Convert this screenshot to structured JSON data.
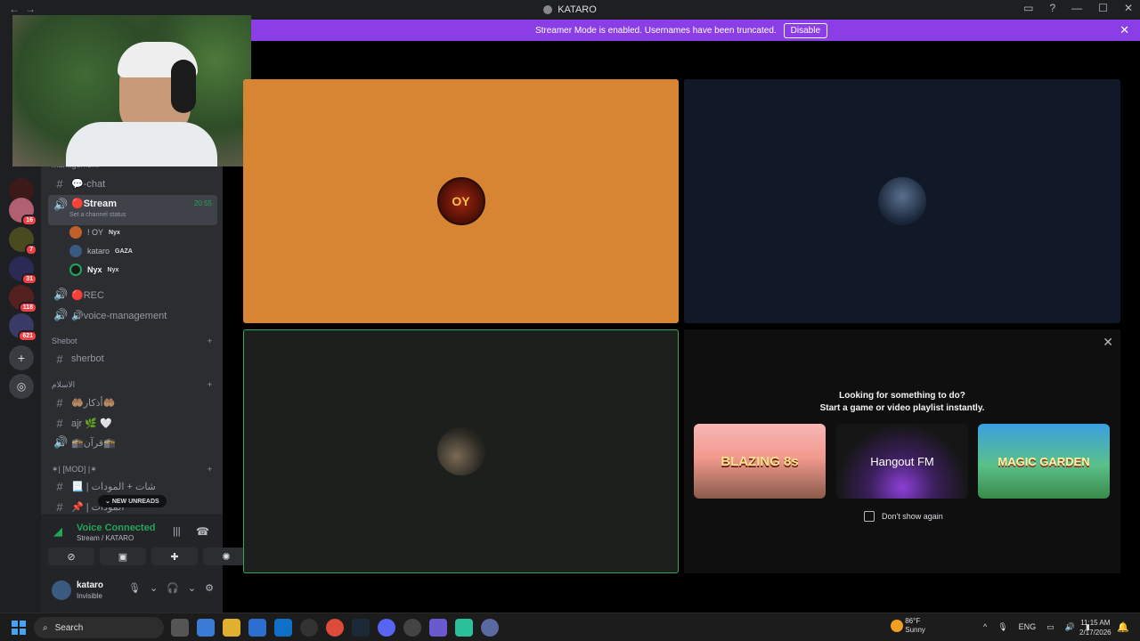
{
  "window": {
    "title": "KATARO",
    "back": "←",
    "forward": "→"
  },
  "banner": {
    "text": "Streamer Mode is enabled. Usernames have been truncated.",
    "button": "Disable"
  },
  "servers": [
    {
      "badge": "16"
    },
    {
      "badge": "7"
    },
    {
      "badge": "31"
    },
    {
      "badge": "118"
    },
    {
      "badge": "621"
    }
  ],
  "channels": {
    "partial_category": "Management",
    "items": [
      {
        "icon": "#",
        "name": "💬-chat"
      },
      {
        "icon": "🔊",
        "name": "🔴Stream",
        "status": "Set a channel status",
        "time": "20:55"
      },
      {
        "icon": "🔊",
        "name": "🔴REC"
      },
      {
        "icon": "🔊",
        "name": "🔊voice-management"
      }
    ],
    "voice_users": [
      {
        "name": "! OY",
        "tag": "Nyx"
      },
      {
        "name": "kataro",
        "tag": "GAZA"
      },
      {
        "name": "Nyx",
        "tag": "Nyx"
      }
    ],
    "cat_shebot": "Shebot",
    "sherbot": "sherbot",
    "cat_islam": "الاسلام",
    "islam": [
      {
        "icon": "#",
        "name": "🤲🏽أذكار🤲🏽"
      },
      {
        "icon": "#",
        "name": "ajr 🌿 🤍"
      },
      {
        "icon": "🔊",
        "name": "🕋قرآن🕋"
      }
    ],
    "cat_mod": "✶| [MOD] |✶",
    "mod": [
      {
        "icon": "#",
        "name": "📃 | شات + المودات"
      },
      {
        "icon": "#",
        "name": "📌 | المودات"
      }
    ],
    "new_unreads": "NEW UNREADS"
  },
  "voice": {
    "title": "Voice Connected",
    "sub": "Stream / KATARO"
  },
  "user": {
    "name": "kataro",
    "status": "Invisible"
  },
  "tiles": [
    {
      "label": "OY",
      "bg": "#d88533"
    },
    {
      "label": "",
      "bg": "#111827"
    },
    {
      "label": "",
      "bg": "#1d1f1c"
    }
  ],
  "activity": {
    "line1": "Looking for something to do?",
    "line2": "Start a game or video playlist instantly.",
    "cards": [
      "BLAZING 8s",
      "Hangout FM",
      "MAGIC GARDEN"
    ],
    "dont_show": "Don't show again"
  },
  "taskbar": {
    "search": "Search",
    "temp": "86°F",
    "weather": "Sunny",
    "lang": "ENG",
    "time": "11:15 AM",
    "date": "2/17/2026"
  }
}
